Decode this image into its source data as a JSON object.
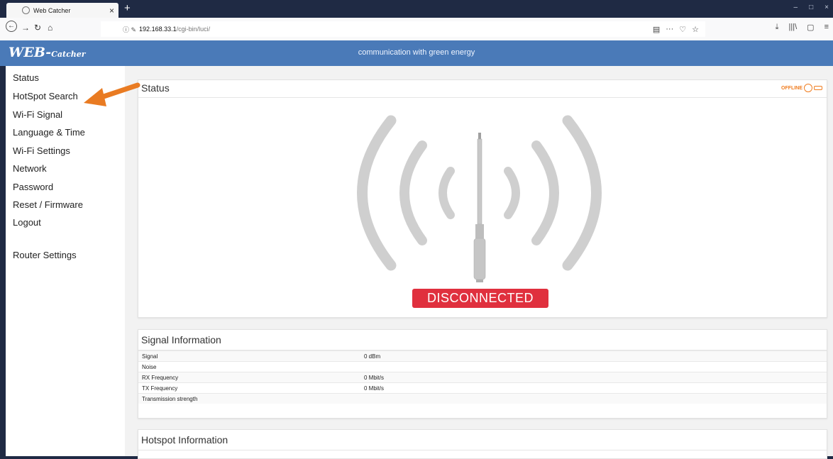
{
  "browser": {
    "tab_title": "Web Catcher",
    "tab_close": "×",
    "new_tab": "+",
    "url_info": "ⓘ ✎",
    "url_host": "192.168.33.1",
    "url_path": "/cgi-bin/luci/",
    "url_actions": [
      "▤",
      "···",
      "♡",
      "☆"
    ],
    "toolbar": [
      "⤓",
      "|||\\",
      "▢",
      "≡"
    ],
    "window_buttons": [
      "–",
      "□",
      "×"
    ]
  },
  "app": {
    "logo_main": "WEB-",
    "logo_sub": "Catcher",
    "tagline": "communication with green energy"
  },
  "sidebar": {
    "items": [
      {
        "label": "Status"
      },
      {
        "label": "HotSpot Search"
      },
      {
        "label": "Wi-Fi Signal"
      },
      {
        "label": "Language & Time"
      },
      {
        "label": "Wi-Fi Settings"
      },
      {
        "label": "Network"
      },
      {
        "label": "Password"
      },
      {
        "label": "Reset / Firmware"
      },
      {
        "label": "Logout"
      }
    ],
    "router_settings": "Router Settings"
  },
  "status_card": {
    "title": "Status",
    "offline_label": "OFFLINE",
    "connection_state": "DISCONNECTED"
  },
  "signal_card": {
    "title": "Signal Information",
    "rows": [
      {
        "label": "Signal",
        "value": "0 dBm"
      },
      {
        "label": "Noise",
        "value": ""
      },
      {
        "label": "RX Frequency",
        "value": "0 Mbit/s"
      },
      {
        "label": "TX Frequency",
        "value": "0 Mbit/s"
      },
      {
        "label": "Transmission strength",
        "value": ""
      }
    ]
  },
  "hotspot_card": {
    "title": "Hotspot Information"
  },
  "colors": {
    "header_blue": "#4a7ab8",
    "disconnected_red": "#e0303e",
    "offline_orange": "#f07c1e",
    "arrow_orange": "#e97b22"
  }
}
